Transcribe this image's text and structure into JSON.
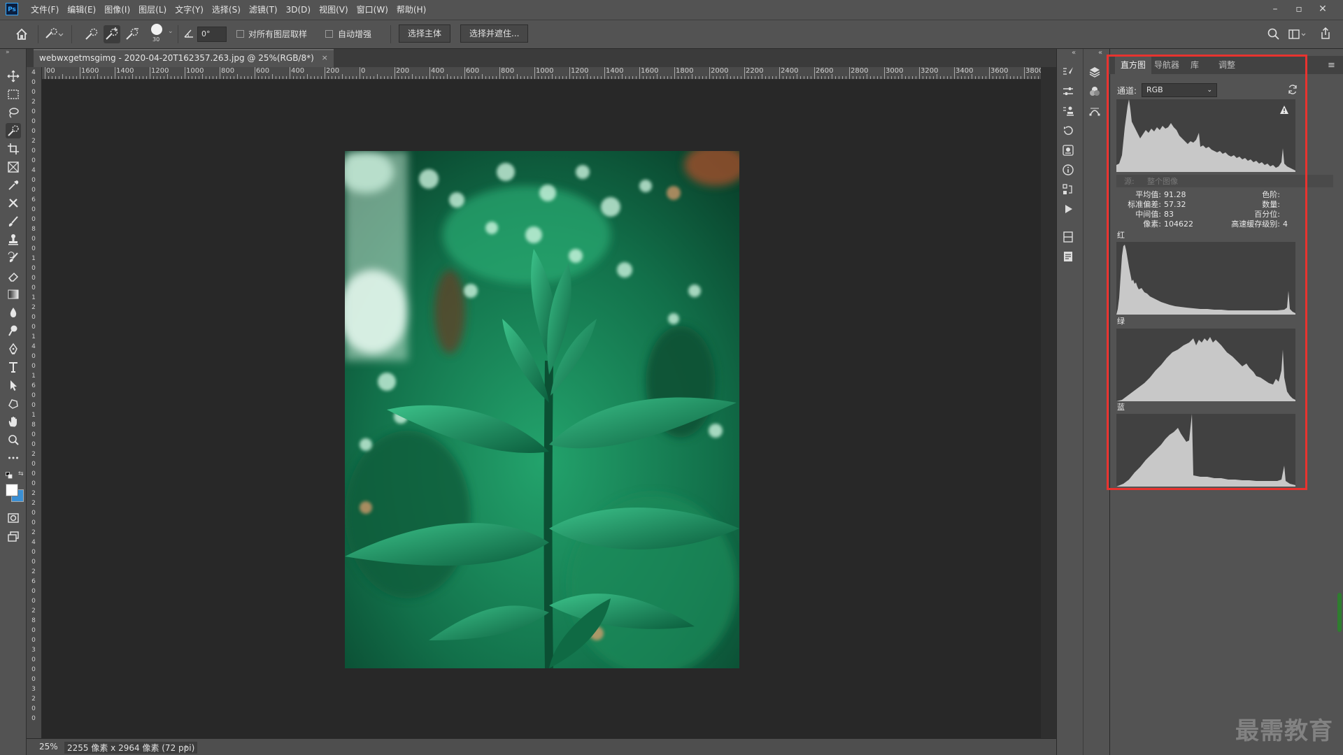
{
  "app": {
    "logo_text": "Ps"
  },
  "menu": [
    "文件(F)",
    "编辑(E)",
    "图像(I)",
    "图层(L)",
    "文字(Y)",
    "选择(S)",
    "滤镜(T)",
    "3D(D)",
    "视图(V)",
    "窗口(W)",
    "帮助(H)"
  ],
  "options_bar": {
    "brush_size": "30",
    "angle_value": "0°",
    "sample_all_layers_label": "对所有图层取样",
    "auto_enhance_label": "自动增强",
    "select_subject_label": "选择主体",
    "select_and_mask_label": "选择并遮住..."
  },
  "document": {
    "tab_title": "webwxgetmsgimg - 2020-04-20T162357.263.jpg @ 25%(RGB/8*)",
    "zoom": "25%",
    "size_info": "2255 像素 x 2964 像素 (72 ppi)"
  },
  "ruler_h_labels": [
    "00",
    "1600",
    "1400",
    "1200",
    "1000",
    "800",
    "600",
    "400",
    "200",
    "0",
    "200",
    "400",
    "600",
    "800",
    "1000",
    "1200",
    "1400",
    "1600",
    "1800",
    "2000",
    "2200",
    "2400",
    "2600",
    "2800",
    "3000",
    "3200",
    "3400",
    "3600",
    "3800"
  ],
  "ruler_v_digits": [
    "4",
    "0",
    "0",
    "2",
    "0",
    "0",
    "0",
    "2",
    "0",
    "0",
    "4",
    "0",
    "0",
    "6",
    "0",
    "0",
    "8",
    "0",
    "0",
    "1",
    "0",
    "0",
    "0",
    "1",
    "2",
    "0",
    "0",
    "1",
    "4",
    "0",
    "0",
    "1",
    "6",
    "0",
    "0",
    "1",
    "8",
    "0",
    "0",
    "2",
    "0",
    "0",
    "0",
    "2",
    "2",
    "0",
    "0",
    "2",
    "4",
    "0",
    "0",
    "2",
    "6",
    "0",
    "0",
    "2",
    "8",
    "0",
    "0",
    "3",
    "0",
    "0",
    "0",
    "3",
    "2",
    "0",
    "0"
  ],
  "panel": {
    "tabs": [
      "直方图",
      "导航器",
      "库",
      "调整"
    ],
    "active_tab": 0,
    "channel_label": "通道:",
    "channel_value": "RGB",
    "source_label": "源:",
    "source_value": "整个图像",
    "stats_left": [
      {
        "label": "平均值:",
        "value": "91.28"
      },
      {
        "label": "标准偏差:",
        "value": "57.32"
      },
      {
        "label": "中间值:",
        "value": "83"
      },
      {
        "label": "像素:",
        "value": "104622"
      }
    ],
    "stats_right": [
      {
        "label": "色阶:",
        "value": ""
      },
      {
        "label": "数量:",
        "value": ""
      },
      {
        "label": "百分位:",
        "value": ""
      },
      {
        "label": "高速缓存级别:",
        "value": "4"
      }
    ],
    "channels": [
      "红",
      "绿",
      "蓝"
    ]
  },
  "colors": {
    "highlight": "#e8332f",
    "histogram_fill": "#c8c8c8",
    "accent": "#31a8ff"
  },
  "watermark": "最需教育"
}
